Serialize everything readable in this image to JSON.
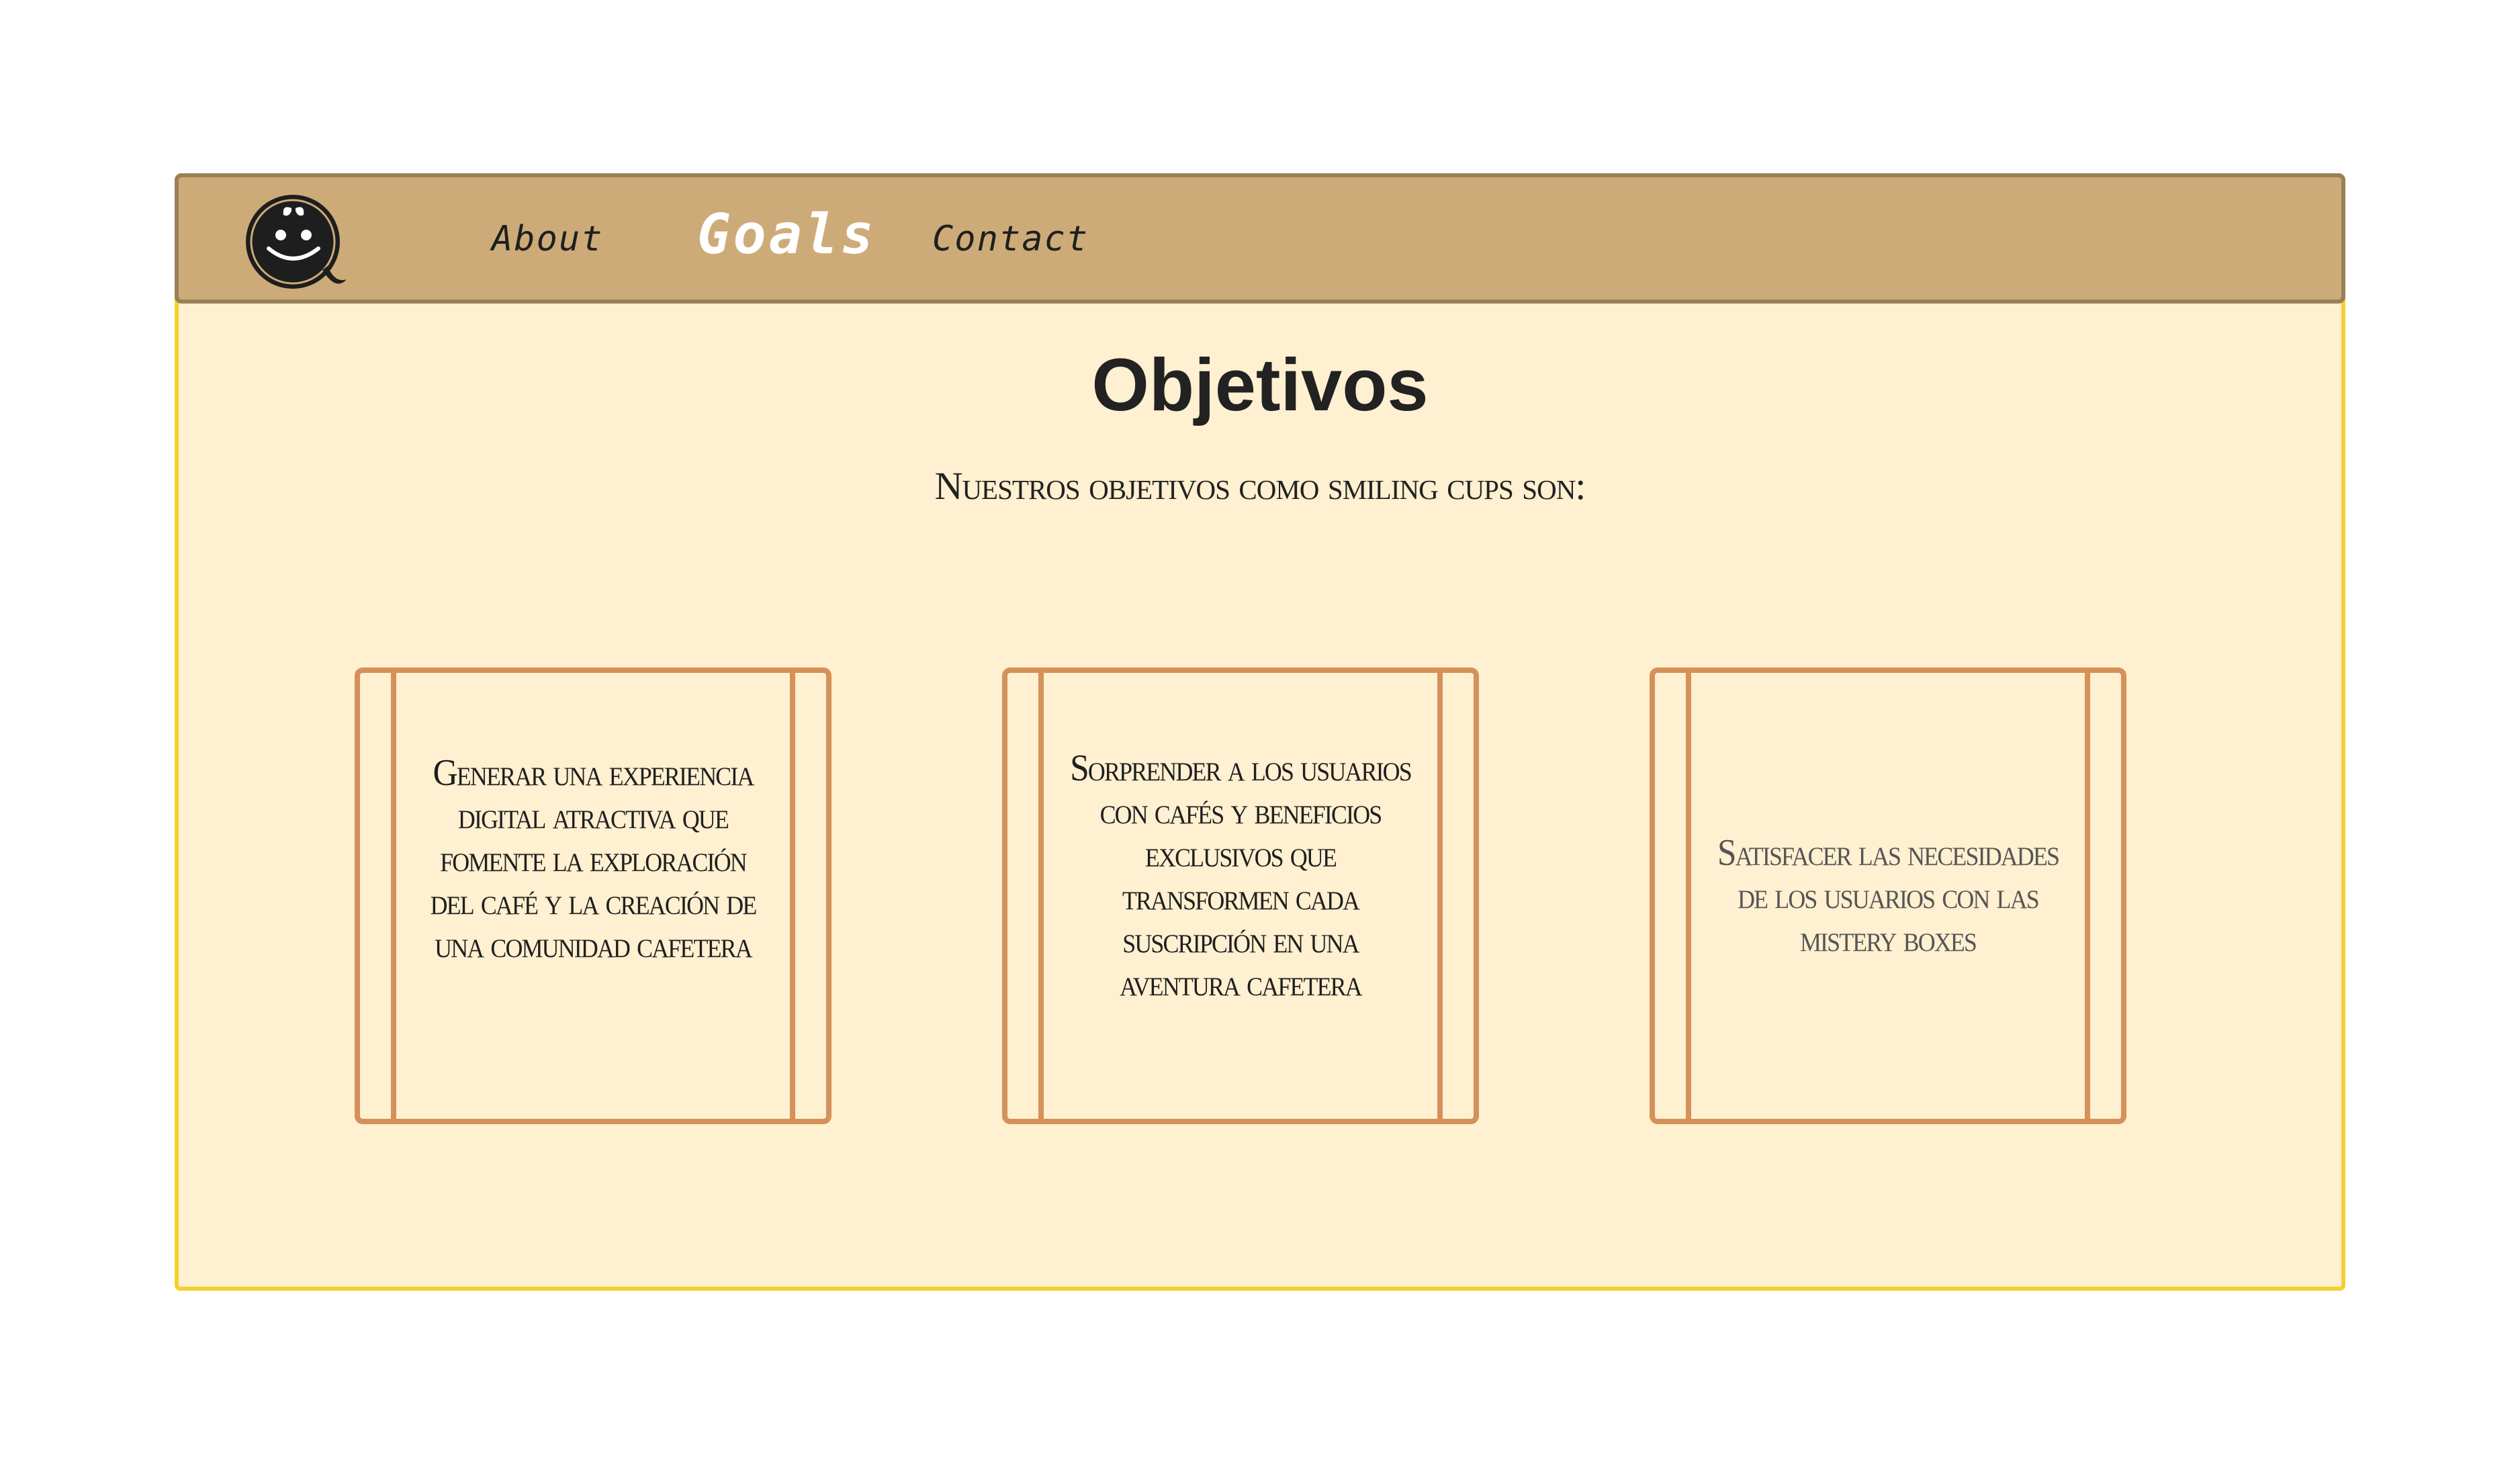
{
  "nav": {
    "logo_icon": "smiling-coffee-cup-logo",
    "links": [
      "About",
      "Goals",
      "Contact"
    ],
    "active": "Goals"
  },
  "main": {
    "title": "Objetivos",
    "subtitle": "Nuestros objetivos como smiling cups son:",
    "cards": [
      "Generar una experiencia digital atractiva que fomente la exploración del café y la creación de una comunidad cafetera",
      "Sorprender a los usuarios con cafés y beneficios exclusivos que transformen cada suscripción en una aventura cafetera",
      "Satisfacer las necesidades de los usuarios con las mistery boxes"
    ]
  },
  "colors": {
    "background": "#fef0d0",
    "navbar": "#cdab78",
    "frame_border": "#f4d12e",
    "card_border": "#d4915a"
  }
}
